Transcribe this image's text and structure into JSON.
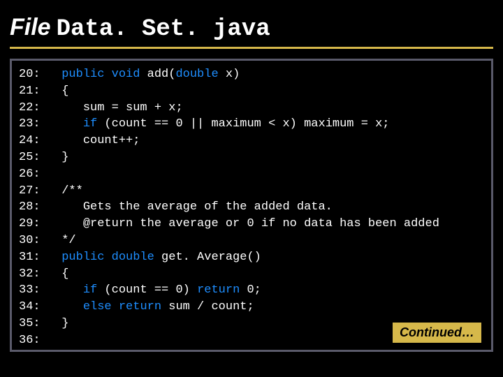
{
  "title": {
    "word": "File",
    "code": "Data. Set. java"
  },
  "continued": "Continued…",
  "lines": [
    {
      "n": "20:",
      "tokens": [
        [
          "plain",
          "   "
        ],
        [
          "kw",
          "public void"
        ],
        [
          "plain",
          " add("
        ],
        [
          "kw",
          "double"
        ],
        [
          "plain",
          " x)"
        ]
      ]
    },
    {
      "n": "21:",
      "tokens": [
        [
          "plain",
          "   {"
        ]
      ]
    },
    {
      "n": "22:",
      "tokens": [
        [
          "plain",
          "      sum = sum + x;"
        ]
      ]
    },
    {
      "n": "23:",
      "tokens": [
        [
          "plain",
          "      "
        ],
        [
          "kw",
          "if"
        ],
        [
          "plain",
          " (count == 0 || maximum < x) maximum = x;"
        ]
      ]
    },
    {
      "n": "24:",
      "tokens": [
        [
          "plain",
          "      count++;"
        ]
      ]
    },
    {
      "n": "25:",
      "tokens": [
        [
          "plain",
          "   }"
        ]
      ]
    },
    {
      "n": "26:",
      "tokens": []
    },
    {
      "n": "27:",
      "tokens": [
        [
          "plain",
          "   /**"
        ]
      ]
    },
    {
      "n": "28:",
      "tokens": [
        [
          "plain",
          "      Gets the average of the added data."
        ]
      ]
    },
    {
      "n": "29:",
      "tokens": [
        [
          "plain",
          "      @return the average or 0 if no data has been added"
        ]
      ]
    },
    {
      "n": "30:",
      "tokens": [
        [
          "plain",
          "   */"
        ]
      ]
    },
    {
      "n": "31:",
      "tokens": [
        [
          "plain",
          "   "
        ],
        [
          "kw",
          "public double"
        ],
        [
          "plain",
          " get. Average()"
        ]
      ]
    },
    {
      "n": "32:",
      "tokens": [
        [
          "plain",
          "   {"
        ]
      ]
    },
    {
      "n": "33:",
      "tokens": [
        [
          "plain",
          "      "
        ],
        [
          "kw",
          "if"
        ],
        [
          "plain",
          " (count == 0) "
        ],
        [
          "kw",
          "return"
        ],
        [
          "plain",
          " 0;"
        ]
      ]
    },
    {
      "n": "34:",
      "tokens": [
        [
          "plain",
          "      "
        ],
        [
          "kw",
          "else return"
        ],
        [
          "plain",
          " sum / count;"
        ]
      ]
    },
    {
      "n": "35:",
      "tokens": [
        [
          "plain",
          "   }"
        ]
      ]
    },
    {
      "n": "36:",
      "tokens": []
    }
  ]
}
